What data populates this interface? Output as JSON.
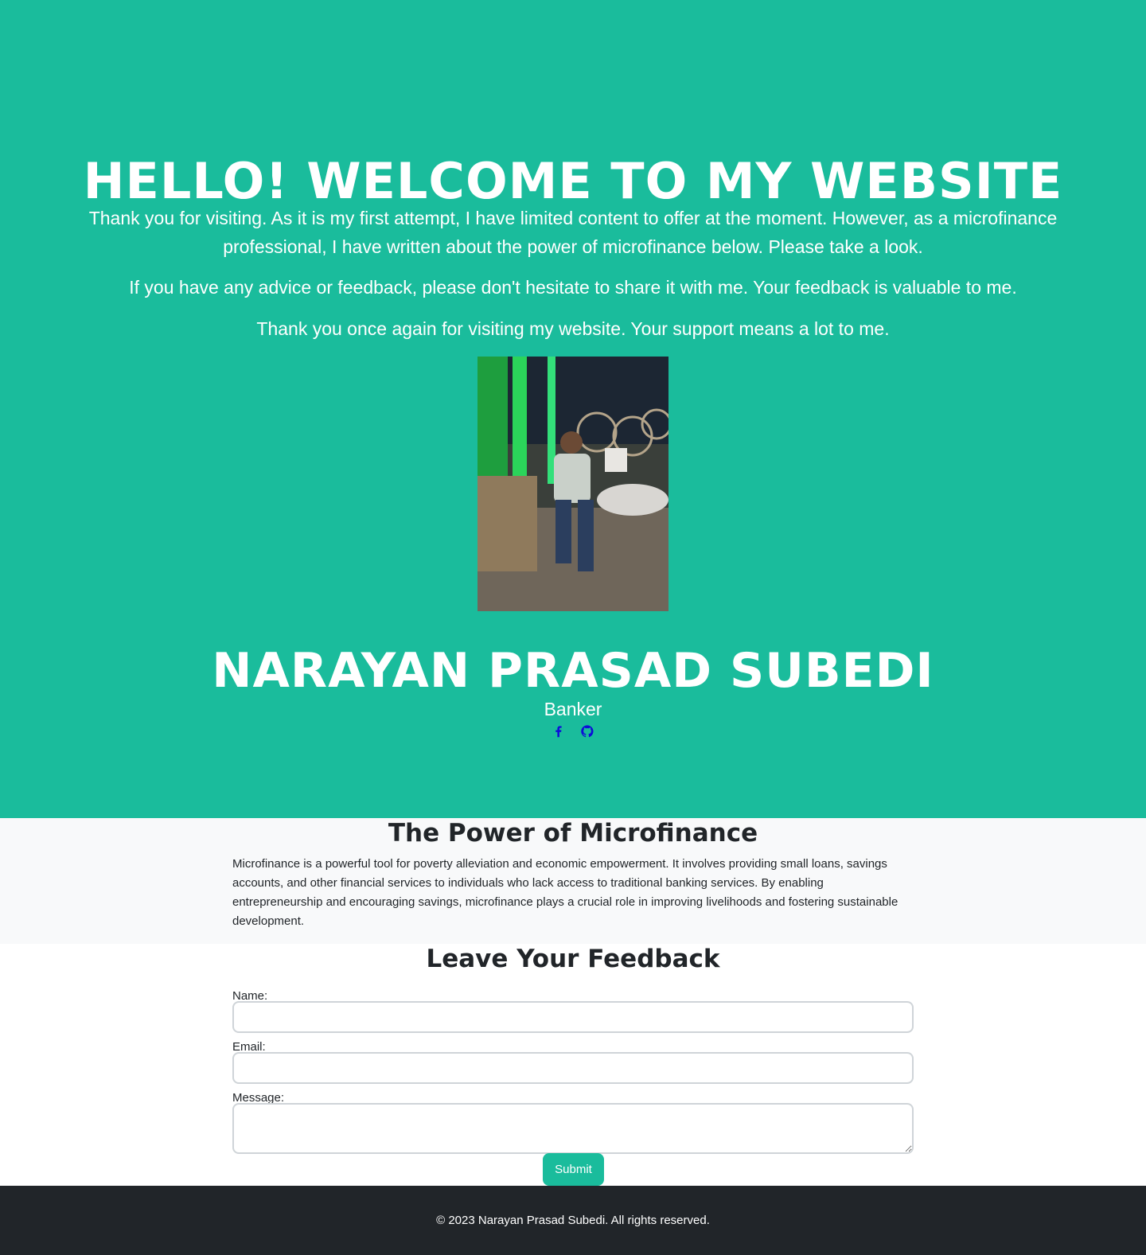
{
  "hero": {
    "title": "HELLO! WELCOME TO MY WEBSITE",
    "paragraphs": [
      "Thank you for visiting. As it is my first attempt, I have limited content to offer at the moment. However, as a microfinance professional, I have written about the power of microfinance below. Please take a look.",
      "If you have any advice or feedback, please don't hesitate to share it with me. Your feedback is valuable to me.",
      "Thank you once again for visiting my website. Your support means a lot to me."
    ],
    "name": "NARAYAN PRASAD SUBEDI",
    "role": "Banker",
    "socials": [
      "facebook-icon",
      "github-icon"
    ]
  },
  "about": {
    "title": "The Power of Microfinance",
    "text": "Microfinance is a powerful tool for poverty alleviation and economic empowerment. It involves providing small loans, savings accounts, and other financial services to individuals who lack access to traditional banking services. By enabling entrepreneurship and encouraging savings, microfinance plays a crucial role in improving livelihoods and fostering sustainable development."
  },
  "feedback": {
    "title": "Leave Your Feedback",
    "name_label": "Name:",
    "email_label": "Email:",
    "message_label": "Message:",
    "name_value": "",
    "email_value": "",
    "message_value": "",
    "submit_label": "Submit"
  },
  "footer": {
    "text": "© 2023 Narayan Prasad Subedi. All rights reserved."
  },
  "colors": {
    "primary": "#1abc9c",
    "social_icon": "#0d0dd8",
    "footer_bg": "#212529",
    "section_bg": "#f8f9fa"
  }
}
